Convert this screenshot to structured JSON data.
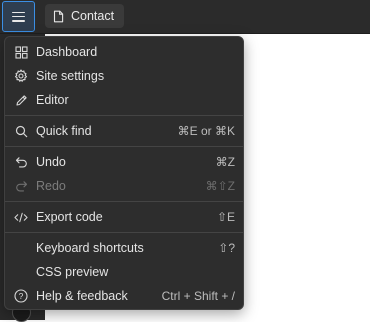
{
  "topbar": {
    "page_tab_label": "Contact"
  },
  "menu": {
    "groups": [
      [
        {
          "label": "Dashboard",
          "icon": "grid-icon",
          "shortcut": ""
        },
        {
          "label": "Site settings",
          "icon": "gear-icon",
          "shortcut": ""
        },
        {
          "label": "Editor",
          "icon": "pencil-icon",
          "shortcut": ""
        }
      ],
      [
        {
          "label": "Quick find",
          "icon": "search-icon",
          "shortcut": "⌘E or ⌘K"
        }
      ],
      [
        {
          "label": "Undo",
          "icon": "undo-icon",
          "shortcut": "⌘Z"
        },
        {
          "label": "Redo",
          "icon": "redo-icon",
          "shortcut": "⌘⇧Z",
          "disabled": true
        }
      ],
      [
        {
          "label": "Export code",
          "icon": "code-icon",
          "shortcut": "⇧E"
        }
      ],
      [
        {
          "label": "Keyboard shortcuts",
          "icon": "",
          "shortcut": "⇧?"
        },
        {
          "label": "CSS preview",
          "icon": "",
          "shortcut": ""
        },
        {
          "label": "Help & feedback",
          "icon": "help-circle-icon",
          "shortcut": "Ctrl + Shift + /"
        }
      ]
    ]
  },
  "colors": {
    "toolbar_bg": "#2b2b2b",
    "menu_bg": "#2d2d2d",
    "focus_accent": "#3b8fe5",
    "text": "#e4e4e4",
    "text_disabled": "#7c7c7c"
  }
}
